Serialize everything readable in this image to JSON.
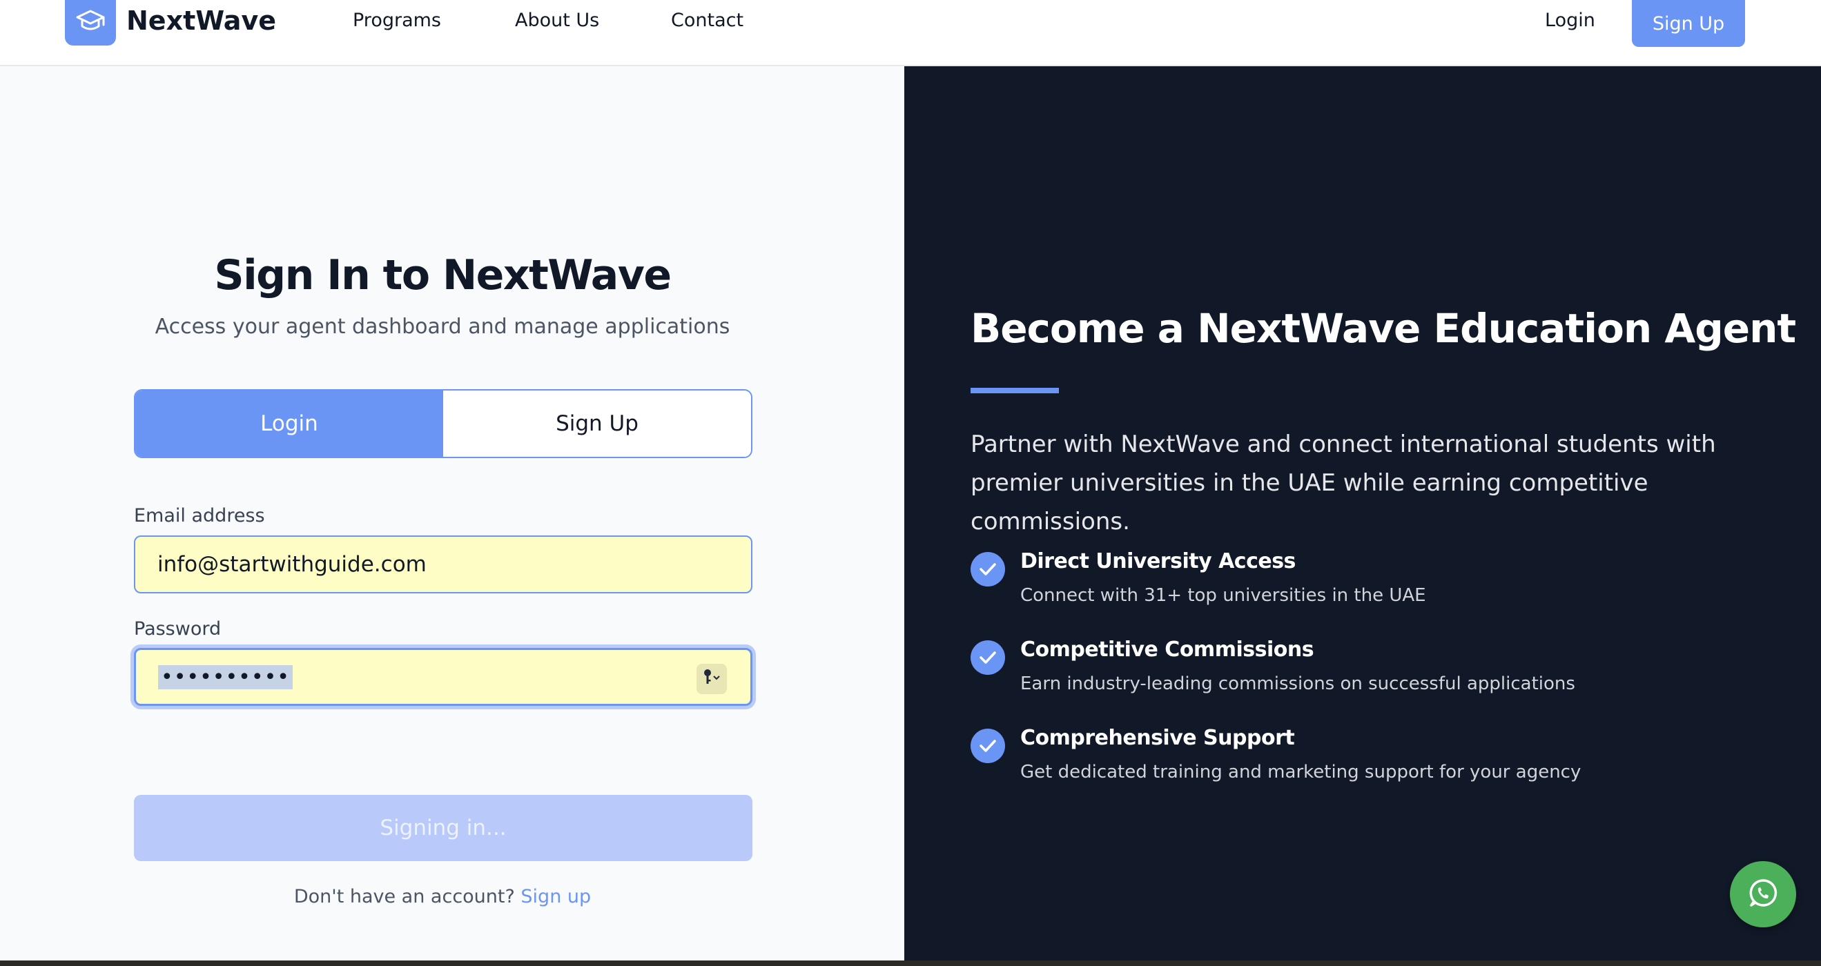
{
  "nav": {
    "brand": "NextWave",
    "links": [
      "Programs",
      "About Us",
      "Contact"
    ],
    "login": "Login",
    "signup": "Sign Up"
  },
  "signin": {
    "title": "Sign In to NextWave",
    "subtitle": "Access your agent dashboard and manage applications",
    "tabs": {
      "login": "Login",
      "signup": "Sign Up",
      "active": "Login"
    },
    "email_label": "Email address",
    "email_value": "info@startwithguide.com",
    "password_label": "Password",
    "password_value": "••••••••••",
    "submit_label": "Signing in...",
    "footer_text": "Don't have an account?",
    "footer_link": "Sign up"
  },
  "promo": {
    "title": "Become a NextWave Education Agent",
    "text": "Partner with NextWave and connect international students with premier universities in the UAE while earning competitive commissions.",
    "features": [
      {
        "title": "Direct University Access",
        "desc": "Connect with 31+ top universities in the UAE"
      },
      {
        "title": "Competitive Commissions",
        "desc": "Earn industry-leading commissions on successful applications"
      },
      {
        "title": "Comprehensive Support",
        "desc": "Get dedicated training and marketing support for your agency"
      }
    ]
  },
  "colors": {
    "accent": "#6b95f5",
    "dark_panel": "#111827",
    "autofill": "#fefdc5",
    "whatsapp": "#4caf5a"
  },
  "icons": {
    "logo": "graduation-cap-icon",
    "feature": "check-icon",
    "password_manager": "key-icon",
    "chat": "whatsapp-icon"
  }
}
